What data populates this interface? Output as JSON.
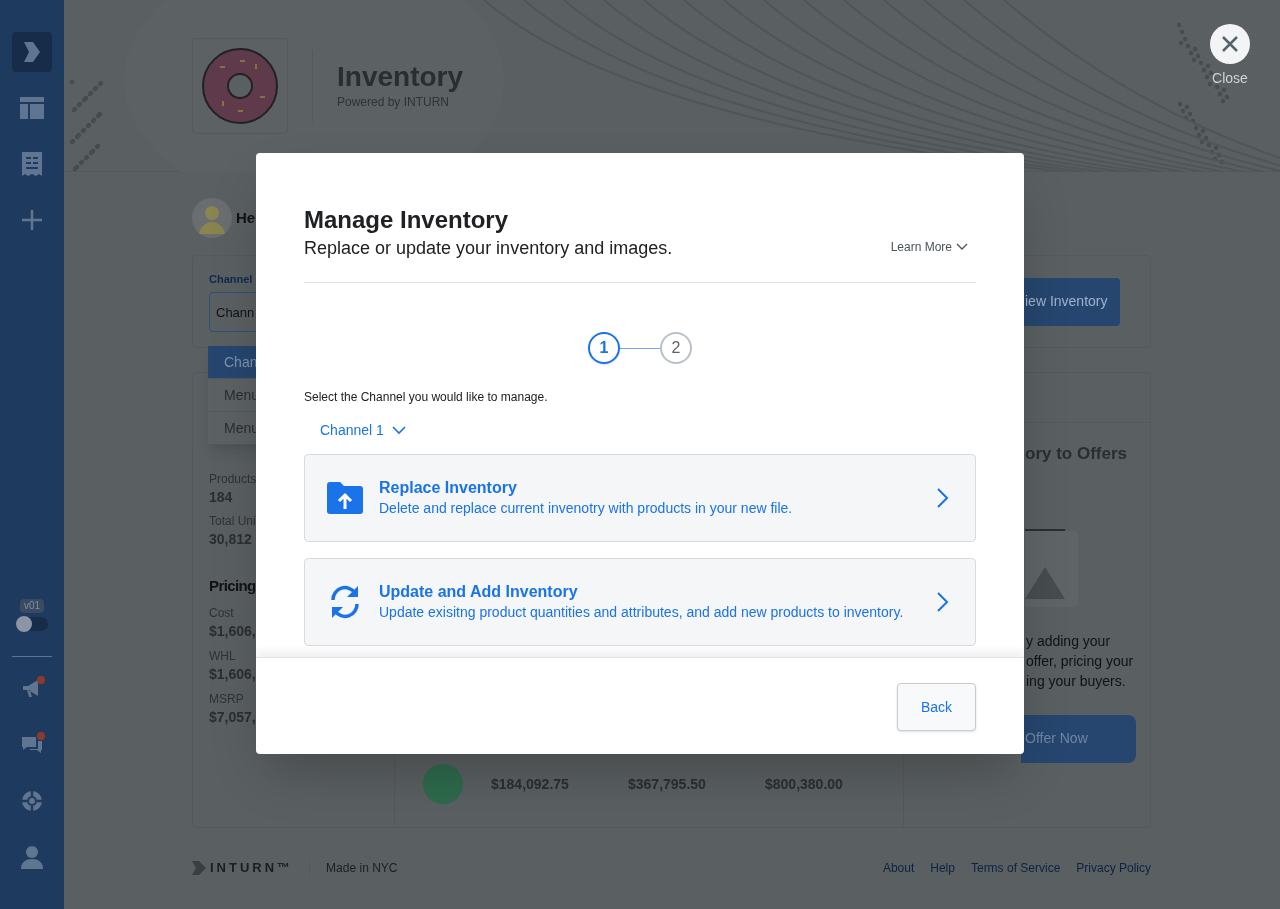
{
  "sidebar": {
    "items": [
      {
        "selected": true
      },
      {
        "selected": false
      },
      {
        "selected": false
      },
      {
        "selected": false
      }
    ],
    "version_badge": "v01",
    "toggle": {
      "on": false
    },
    "bottom_items": [
      {
        "notification": true
      },
      {
        "notification": true
      },
      {
        "notification": false
      },
      {
        "notification": false
      }
    ]
  },
  "close_button": {
    "label": "Close"
  },
  "header": {
    "title": "Inventory",
    "subtitle": "Powered by INTURN"
  },
  "greeting": "He",
  "channel_card": {
    "label": "Channel",
    "value": "Chann",
    "button": "iew Inventory"
  },
  "channel_menu": [
    {
      "label": "Chan",
      "selected": true
    },
    {
      "label": "Menu",
      "selected": false
    },
    {
      "label": "Menu",
      "selected": false
    }
  ],
  "quantity": {
    "stats": [
      {
        "label": "Products",
        "value": "184"
      },
      {
        "label": "Total Uni",
        "value": "30,812"
      }
    ]
  },
  "pricing": {
    "title": "Pricing",
    "stats": [
      {
        "label": "Cost",
        "value": "$1,606,"
      },
      {
        "label": "WHL",
        "value": "$1,606,"
      },
      {
        "label": "MSRP",
        "value": "$7,057,"
      }
    ]
  },
  "channel_summary": {
    "values": [
      "$184,092.75",
      "$367,795.50",
      "$800,380.00"
    ]
  },
  "offers_card": {
    "title": "ory to Offers",
    "text": [
      "y adding your",
      "offer, pricing your",
      "ing your buyers."
    ],
    "button": "Offer Now"
  },
  "footer": {
    "brand": "INTURN™",
    "tagline": "Made in NYC",
    "links": [
      "About",
      "Help",
      "Terms of Service",
      "Privacy Policy"
    ]
  },
  "modal": {
    "title": "Manage Inventory",
    "subtitle": "Replace or update your inventory and images.",
    "learn_more": "Learn More",
    "steps": [
      {
        "label": "1",
        "selected": true
      },
      {
        "label": "2",
        "selected": false
      }
    ],
    "prompt": "Select the Channel you would like to manage.",
    "channel": "Channel 1",
    "options": [
      {
        "kind": "replace",
        "title": "Replace Inventory",
        "description": "Delete and replace current invenotry with products in your new file."
      },
      {
        "kind": "update",
        "title": "Update and Add Inventory",
        "description": "Update exisitng product quantities and attributes, and add new products to inventory."
      }
    ],
    "back_button": "Back"
  }
}
